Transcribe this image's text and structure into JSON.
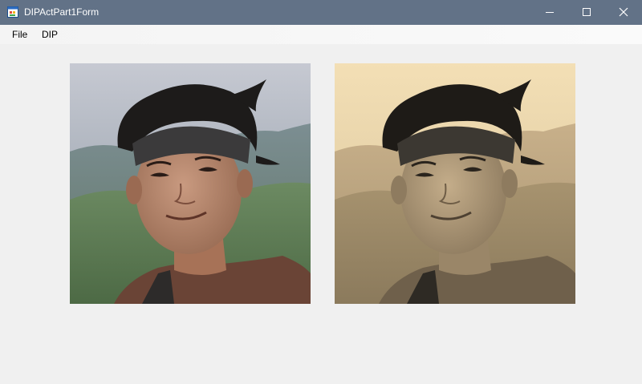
{
  "window": {
    "title": "DIPActPart1Form",
    "icon": "form-app-icon",
    "controls": [
      "minimize-icon",
      "maximize-icon",
      "close-icon"
    ]
  },
  "menu": {
    "items": [
      {
        "label": "File"
      },
      {
        "label": "DIP"
      }
    ]
  },
  "images": [
    {
      "name": "original-photo",
      "filter": "none"
    },
    {
      "name": "processed-photo",
      "filter": "sepia"
    }
  ],
  "colors": {
    "titlebar": "#627287",
    "client_bg": "#f0f0f0"
  }
}
